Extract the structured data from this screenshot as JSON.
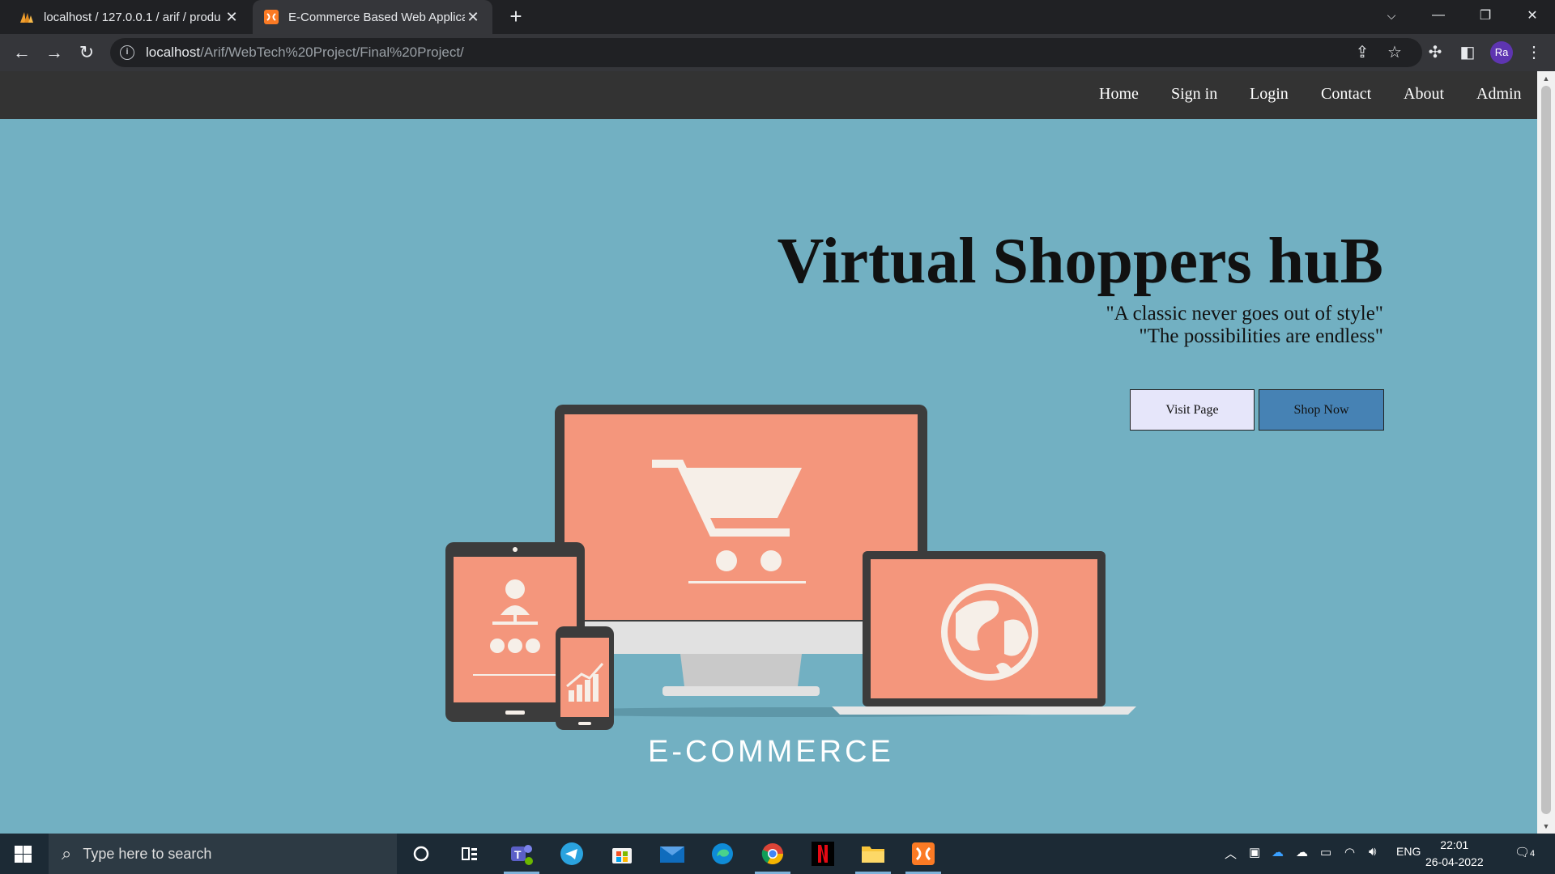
{
  "browser": {
    "tabs": [
      {
        "title": "localhost / 127.0.0.1 / arif / produ",
        "icon": "phpmyadmin-icon"
      },
      {
        "title": "E-Commerce Based Web Applica",
        "icon": "xampp-icon",
        "active": true
      }
    ],
    "new_tab": "+",
    "url_host": "localhost",
    "url_path": "/Arif/WebTech%20Project/Final%20Project/",
    "profile_initials": "Ra"
  },
  "site": {
    "nav": [
      "Home",
      "Sign in",
      "Login",
      "Contact",
      "About",
      "Admin"
    ],
    "hero": {
      "title": "Virtual Shoppers huB",
      "quote1": "\"A classic never goes out of style\"",
      "quote2": "\"The possibilities are endless\"",
      "visit_label": "Visit Page",
      "shop_label": "Shop Now"
    },
    "illustration_label": "E-COMMERCE"
  },
  "colors": {
    "page_bg": "#72b0c2",
    "nav_bg": "#333333",
    "visit_bg": "#e6e6fa",
    "shop_bg": "#4682b4",
    "screen_salmon": "#f4967c",
    "device_frame": "#3c3c3c"
  },
  "taskbar": {
    "search_placeholder": "Type here to search",
    "apps": [
      "cortana-icon",
      "task-view-icon",
      "teams-icon",
      "telegram-icon",
      "store-icon",
      "mail-icon",
      "edge-icon",
      "chrome-icon",
      "netflix-icon",
      "file-explorer-icon",
      "xampp-icon"
    ],
    "language": "ENG",
    "time": "22:01",
    "date": "26-04-2022",
    "notifications": "4"
  }
}
